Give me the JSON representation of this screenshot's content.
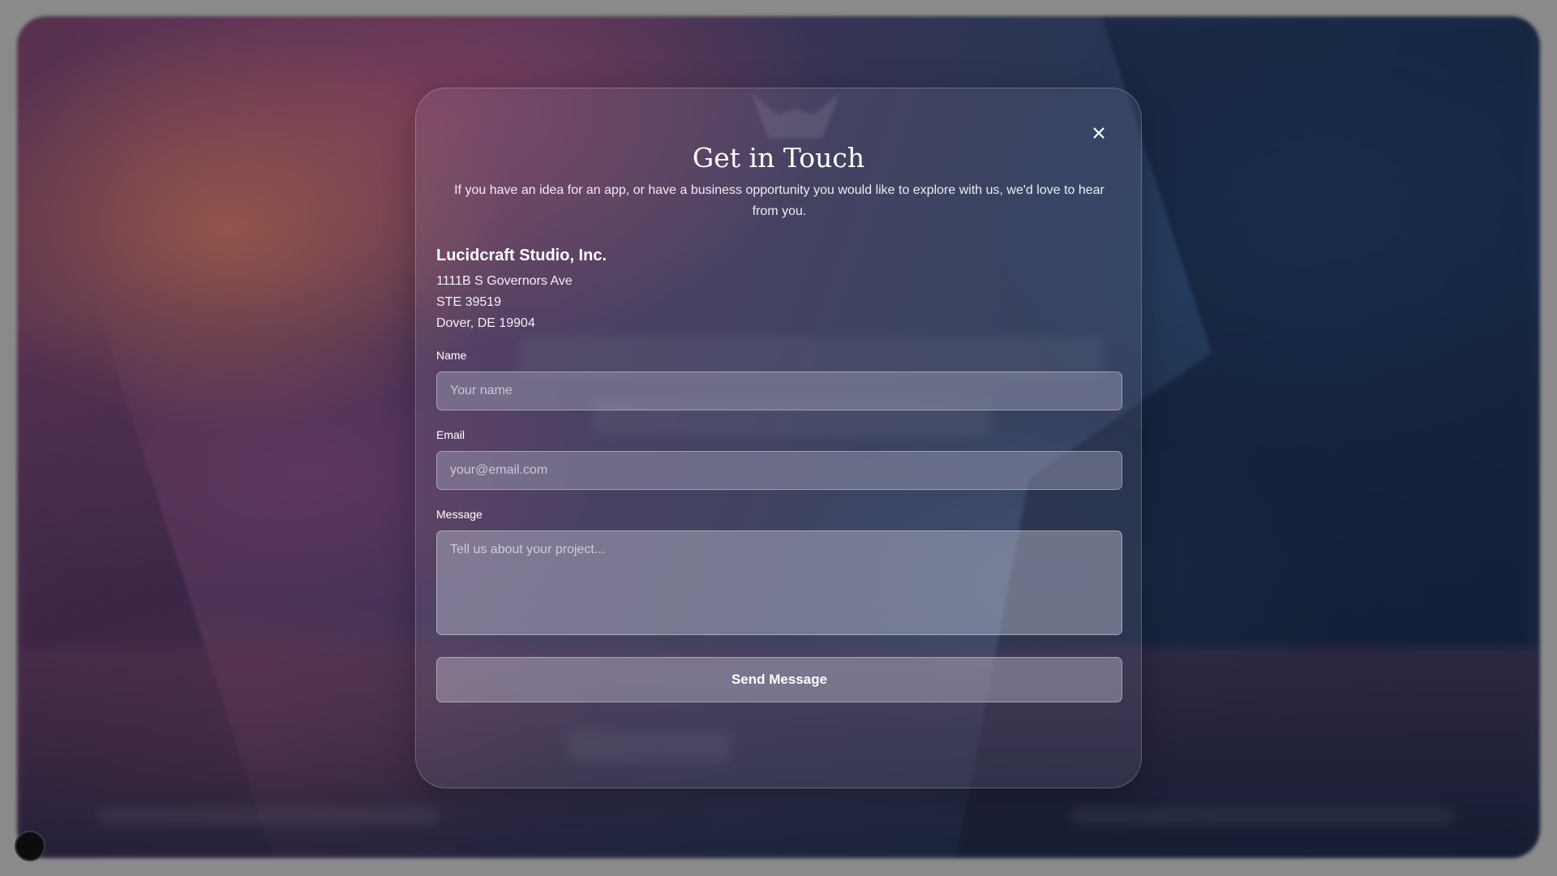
{
  "modal": {
    "title": "Get in Touch",
    "subtitle": "If you have an idea for an app, or have a business opportunity you would like to explore with us, we'd love to hear from you.",
    "close_icon": "close-icon"
  },
  "company": {
    "name": "Lucidcraft Studio, Inc.",
    "address_line1": "1111B S Governors Ave",
    "address_line2": "STE 39519",
    "address_line3": "Dover, DE 19904"
  },
  "form": {
    "name": {
      "label": "Name",
      "placeholder": "Your name",
      "value": ""
    },
    "email": {
      "label": "Email",
      "placeholder": "your@email.com",
      "value": ""
    },
    "message": {
      "label": "Message",
      "placeholder": "Tell us about your project...",
      "value": ""
    },
    "submit_label": "Send Message"
  },
  "colors": {
    "overlay": "#8a8a8a",
    "text": "#ffffff",
    "corner_dot": "#0c0c0f"
  }
}
